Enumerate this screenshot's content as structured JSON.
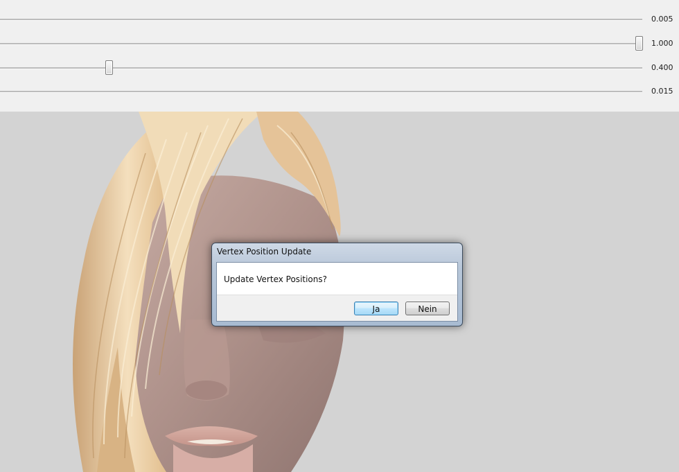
{
  "sliders": [
    {
      "value_label": "0.005",
      "position": null
    },
    {
      "value_label": "1.000",
      "position": 1.0
    },
    {
      "value_label": "0.400",
      "position": 0.17
    },
    {
      "value_label": "0.015",
      "position": null
    }
  ],
  "dialog": {
    "title": "Vertex Position Update",
    "message": "Update Vertex Positions?",
    "yes_label": "Ja",
    "no_label": "Nein"
  },
  "colors": {
    "panel_bg": "#f0f0f0",
    "viewport_bg": "#d3d3d3",
    "hair": "#e8c9a0",
    "skin": "#b59a92"
  }
}
